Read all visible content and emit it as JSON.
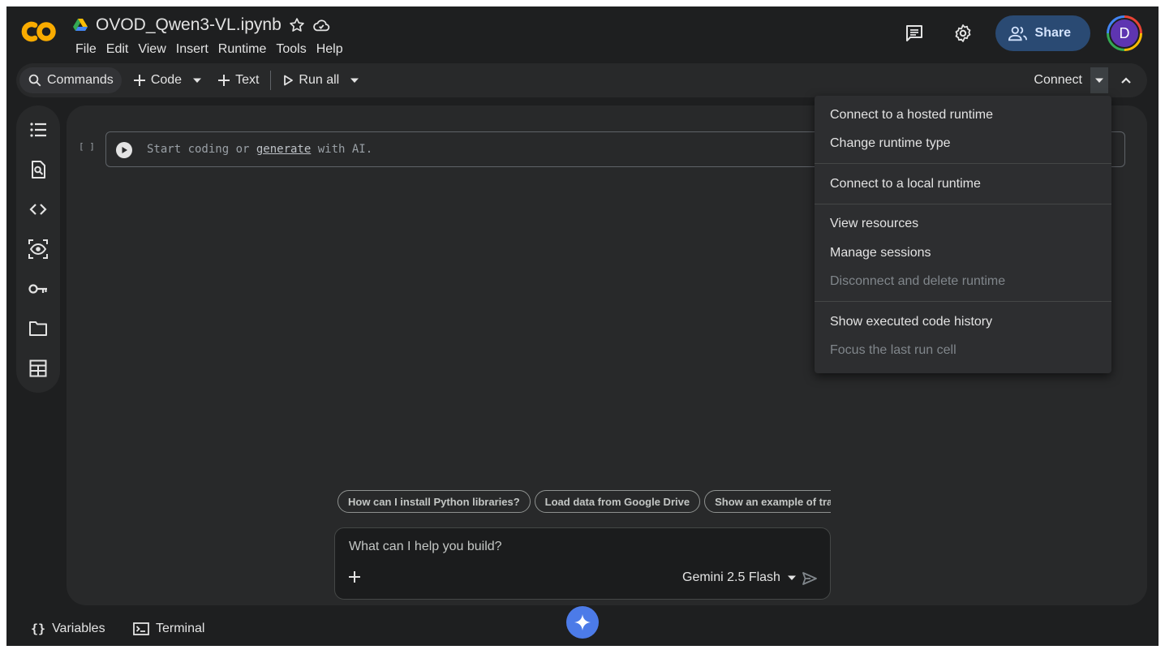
{
  "app": {
    "logo_text": "CO",
    "title": "OVOD_Qwen3-VL.ipynb",
    "icons": {
      "drive": "google-drive-icon",
      "star": "star-icon",
      "cloud": "cloud-sync-icon"
    }
  },
  "menubar": [
    "File",
    "Edit",
    "View",
    "Insert",
    "Runtime",
    "Tools",
    "Help"
  ],
  "header_right": {
    "comments_icon": "comments-icon",
    "settings_icon": "gear-icon",
    "share_label": "Share",
    "avatar_initial": "D"
  },
  "toolbar": {
    "commands_label": "Commands",
    "code_label": "Code",
    "text_label": "Text",
    "run_all_label": "Run all",
    "connect_label": "Connect"
  },
  "side_rail": [
    "table-of-contents-icon",
    "find-icon",
    "code-snippets-icon",
    "variable-inspector-icon",
    "secrets-key-icon",
    "files-folder-icon",
    "data-table-icon"
  ],
  "cell": {
    "exec_count": "[ ]",
    "placeholder_before": "Start coding or ",
    "placeholder_link": "generate",
    "placeholder_after": " with AI."
  },
  "runtime_menu": {
    "connect_hosted": "Connect to a hosted runtime",
    "change_type": "Change runtime type",
    "connect_local": "Connect to a local runtime",
    "view_resources": "View resources",
    "manage_sessions": "Manage sessions",
    "disconnect_delete": "Disconnect and delete runtime",
    "show_history": "Show executed code history",
    "focus_last": "Focus the last run cell"
  },
  "suggestions": [
    "How can I install Python libraries?",
    "Load data from Google Drive",
    "Show an example of training a"
  ],
  "prompt": {
    "placeholder": "What can I help you build?",
    "model": "Gemini 2.5 Flash"
  },
  "bottom_bar": {
    "variables_label": "Variables",
    "terminal_label": "Terminal"
  },
  "colors": {
    "background": "#1e1f20",
    "surface": "#28292a",
    "share_button": "#2a4a73",
    "gemini_fab": "#4c7be8",
    "logo_orange": "#f9ab00"
  }
}
